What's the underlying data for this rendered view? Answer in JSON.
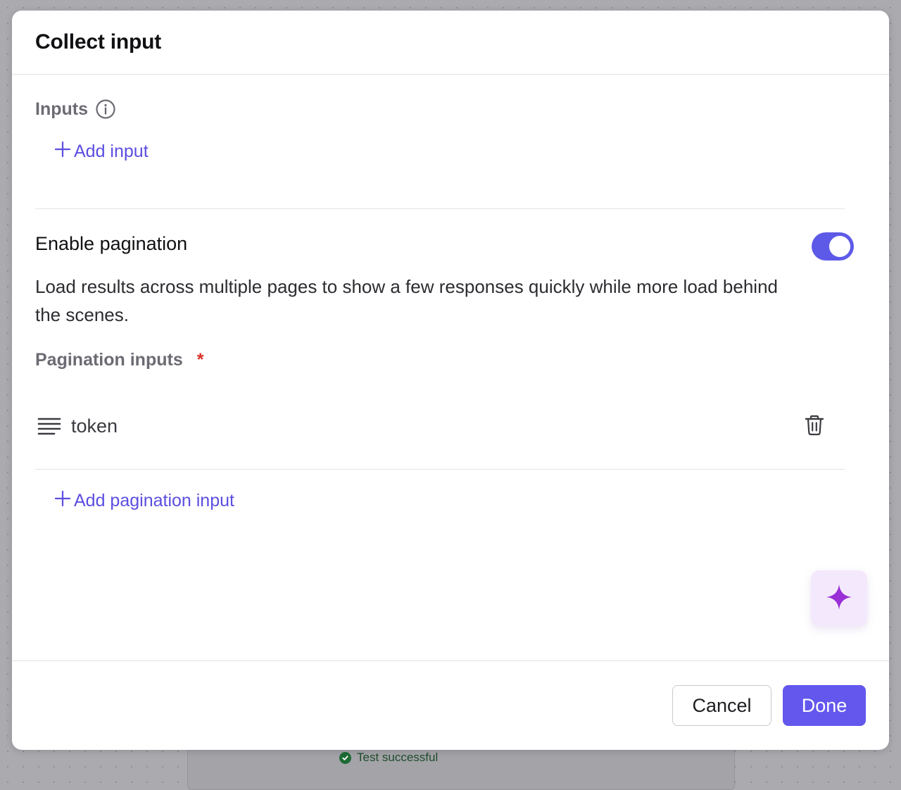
{
  "modal": {
    "title": "Collect input"
  },
  "inputs_section": {
    "label": "Inputs",
    "add_label": "Add input"
  },
  "pagination": {
    "title": "Enable pagination",
    "enabled": true,
    "description": "Load results across multiple pages to show a few responses quickly while more load behind the scenes.",
    "inputs_label": "Pagination inputs",
    "required_marker": "*",
    "items": [
      {
        "label": "token",
        "type_icon": "text-lines-icon"
      }
    ],
    "add_label": "Add pagination input"
  },
  "footer": {
    "cancel_label": "Cancel",
    "done_label": "Done"
  },
  "background": {
    "status_text": "Test successful"
  },
  "colors": {
    "accent": "#6357ee",
    "link": "#5b4ee0",
    "toggle_on": "#5e5ae8",
    "required": "#d93025",
    "ai_fab_bg": "#f4e9fc",
    "ai_sparkle": "#9a2fd6",
    "success": "#1f6b36"
  },
  "icons": {
    "info": "info-icon",
    "plus": "plus-icon",
    "text_lines": "text-lines-icon",
    "trash": "trash-icon",
    "sparkle": "sparkle-icon",
    "check": "check-circle-icon"
  }
}
